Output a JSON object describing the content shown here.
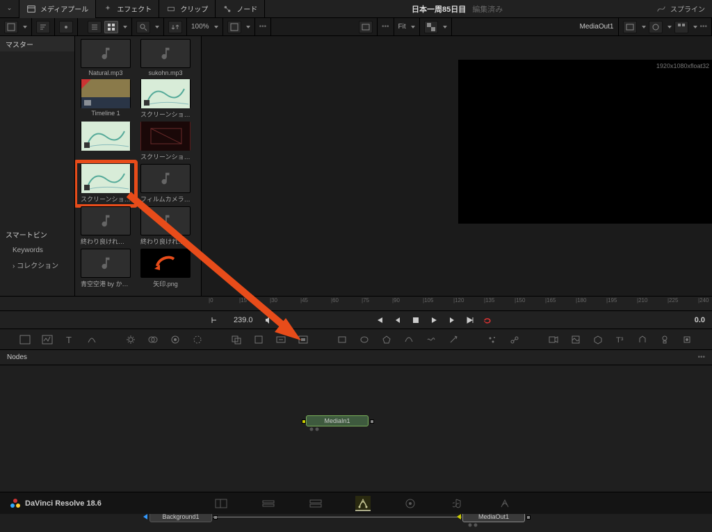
{
  "topbar": {
    "tabs": [
      "メディアプール",
      "エフェクト",
      "クリップ",
      "ノード"
    ],
    "project_title": "日本一周85日目",
    "project_status": "編集済み",
    "right_tab": "スプライン"
  },
  "toolbar2": {
    "zoom": "100%",
    "fit_label": "Fit",
    "output_label": "MediaOut1"
  },
  "lefttree": {
    "master": "マスター",
    "smartbin": "スマートビン",
    "keywords": "Keywords",
    "collection": "コレクション"
  },
  "clips": [
    [
      {
        "type": "audio",
        "name": "Natural.mp3"
      },
      {
        "type": "audio",
        "name": "sukohn.mp3"
      }
    ],
    [
      {
        "type": "timeline",
        "name": "Timeline 1"
      },
      {
        "type": "map",
        "name": "スクリーンショット ..."
      }
    ],
    [
      {
        "type": "map",
        "name": ""
      },
      {
        "type": "redfx",
        "name": "スクリーンショット ..."
      }
    ],
    [
      {
        "type": "map",
        "name": "スクリーンショット ...",
        "selected": true
      },
      {
        "type": "audio",
        "name": "フィルムカメラのシ..."
      }
    ],
    [
      {
        "type": "audio",
        "name": "終わり良ければ全て..."
      },
      {
        "type": "audio",
        "name": "終わり良ければ全て..."
      }
    ],
    [
      {
        "type": "audio",
        "name": "青空空港 by かずち..."
      },
      {
        "type": "arrow",
        "name": "矢印.png"
      }
    ]
  ],
  "viewer": {
    "meta": "1920x1080xfloat32",
    "fit": "Fit",
    "out": "MediaOut1"
  },
  "ruler": [
    0,
    15,
    30,
    45,
    60,
    75,
    90,
    105,
    120,
    135,
    150,
    165,
    180,
    195,
    210,
    225,
    240
  ],
  "transport": {
    "frame_in": "0",
    "frame": "239.0",
    "display": "0.0"
  },
  "nodes": {
    "panel_title": "Nodes",
    "node1": "MediaIn1",
    "node2": "Background1",
    "node3": "MediaOut1"
  },
  "bottom": {
    "brand": "DaVinci Resolve 18.6"
  }
}
